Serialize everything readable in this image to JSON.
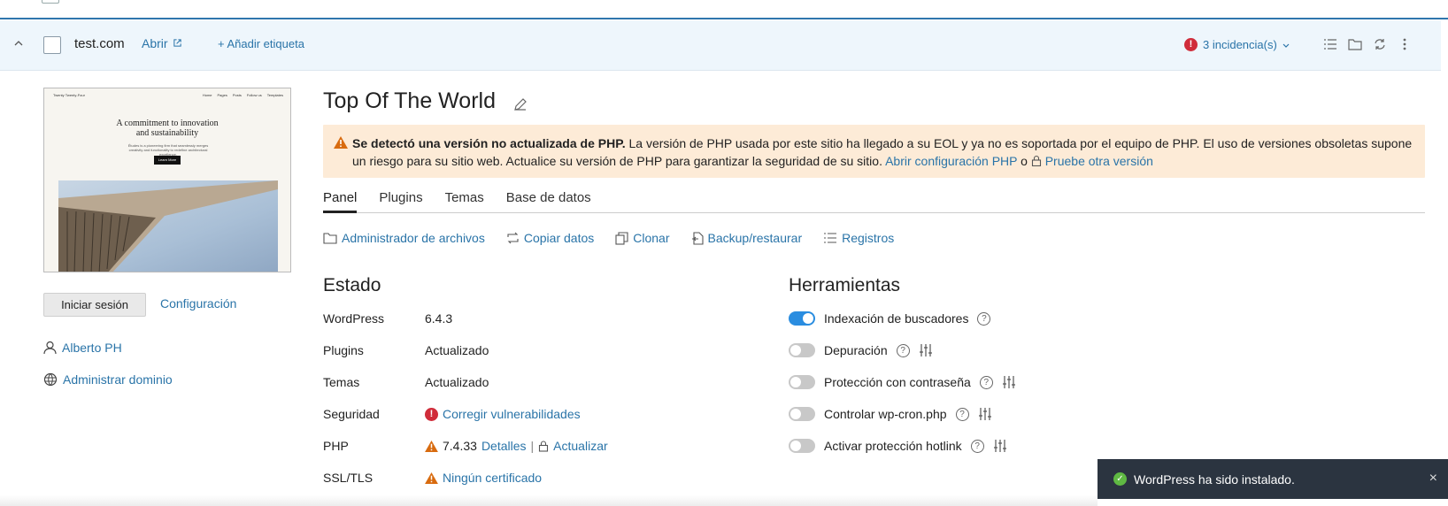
{
  "header": {
    "domain": "test.com",
    "open_label": "Abrir",
    "add_tag_label": "+ Añadir etiqueta",
    "issues_label": "3 incidencia(s)",
    "issues_icon_text": "!"
  },
  "thumbnail": {
    "nav_brand": "Twenty Twenty-Four",
    "nav_links": [
      "Home",
      "Pages",
      "Posts",
      "Follow us",
      "Templates"
    ],
    "headline": "A commitment to innovation and sustainability",
    "body": "Études is a pioneering firm that seamlessly merges creativity and functionality to redefine architectural excellence.",
    "button": "Learn More"
  },
  "sidebar": {
    "login_button": "Iniciar sesión",
    "config_link": "Configuración",
    "user_link": "Alberto PH",
    "domain_link": "Administrar dominio"
  },
  "site": {
    "title": "Top Of The World"
  },
  "warning": {
    "bold": "Se detectó una versión no actualizada de PHP.",
    "text": " La versión de PHP usada por este sitio ha llegado a su EOL y ya no es soportada por el equipo de PHP. El uso de versiones obsoletas supone un riesgo para su sitio web. Actualice su versión de PHP para garantizar la seguridad de su sitio. ",
    "link1": "Abrir configuración PHP",
    "or": " o ",
    "link2": "Pruebe otra versión"
  },
  "tabs": [
    "Panel",
    "Plugins",
    "Temas",
    "Base de datos"
  ],
  "actions": [
    "Administrador de archivos",
    "Copiar datos",
    "Clonar",
    "Backup/restaurar",
    "Registros"
  ],
  "status": {
    "title": "Estado",
    "rows": [
      {
        "label": "WordPress",
        "value": "6.4.3"
      },
      {
        "label": "Plugins",
        "value": "Actualizado"
      },
      {
        "label": "Temas",
        "value": "Actualizado"
      },
      {
        "label": "Seguridad",
        "value": "Corregir vulnerabilidades"
      },
      {
        "label": "PHP",
        "value": "7.4.33",
        "details": "Detalles",
        "sep": "|",
        "update": "Actualizar"
      },
      {
        "label": "SSL/TLS",
        "value": "Ningún certificado"
      }
    ]
  },
  "tools": {
    "title": "Herramientas",
    "rows": [
      {
        "label": "Indexación de buscadores",
        "on": true
      },
      {
        "label": "Depuración",
        "on": false
      },
      {
        "label": "Protección con contraseña",
        "on": false
      },
      {
        "label": "Controlar wp-cron.php",
        "on": false
      },
      {
        "label": "Activar protección hotlink",
        "on": false
      }
    ]
  },
  "toast": {
    "message": "WordPress ha sido instalado.",
    "close": "×"
  },
  "colors": {
    "accent": "#2a74a8",
    "warning_bg": "#fdebd7",
    "error": "#d02c3a",
    "toggle_on": "#2a8de0"
  }
}
